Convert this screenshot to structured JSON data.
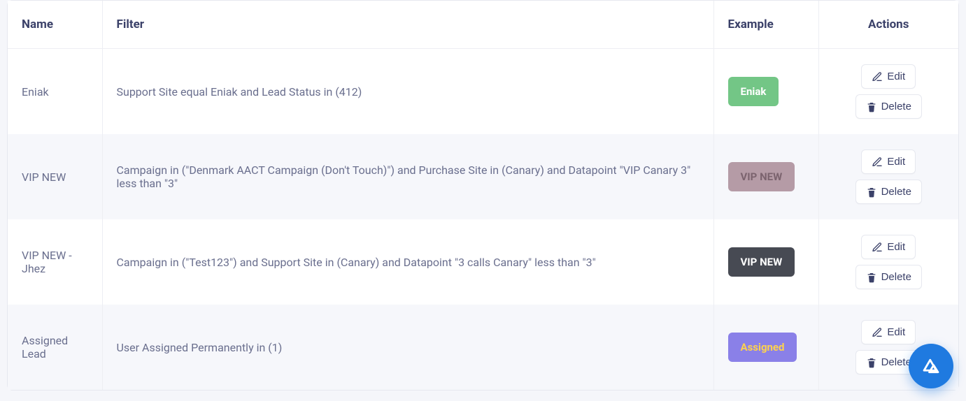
{
  "table": {
    "headers": {
      "name": "Name",
      "filter": "Filter",
      "example": "Example",
      "actions": "Actions"
    },
    "rows": [
      {
        "name": "Eniak",
        "filter": "Support Site equal Eniak and Lead Status in (412)",
        "badge_label": "Eniak",
        "badge_text_color": "#ffffff",
        "badge_bg": "#73c686"
      },
      {
        "name": "VIP NEW",
        "filter": "Campaign in (\"Denmark AACT Campaign (Don't Touch)\") and Purchase Site in (Canary) and Datapoint \"VIP Canary 3\" less than \"3\"",
        "badge_label": "VIP NEW",
        "badge_text_color": "#7b636e",
        "badge_bg": "#b59ba6"
      },
      {
        "name": "VIP NEW - Jhez",
        "filter": "Campaign in (\"Test123\") and Support Site in (Canary) and Datapoint \"3 calls Canary\" less than \"3\"",
        "badge_label": "VIP NEW",
        "badge_text_color": "#ffffff",
        "badge_bg": "#474a53"
      },
      {
        "name": "Assigned Lead",
        "filter": "User Assigned Permanently in (1)",
        "badge_label": "Assigned",
        "badge_text_color": "#ffd24d",
        "badge_bg": "#8a80e8"
      }
    ]
  },
  "actions": {
    "edit_label": "Edit",
    "delete_label": "Delete"
  }
}
